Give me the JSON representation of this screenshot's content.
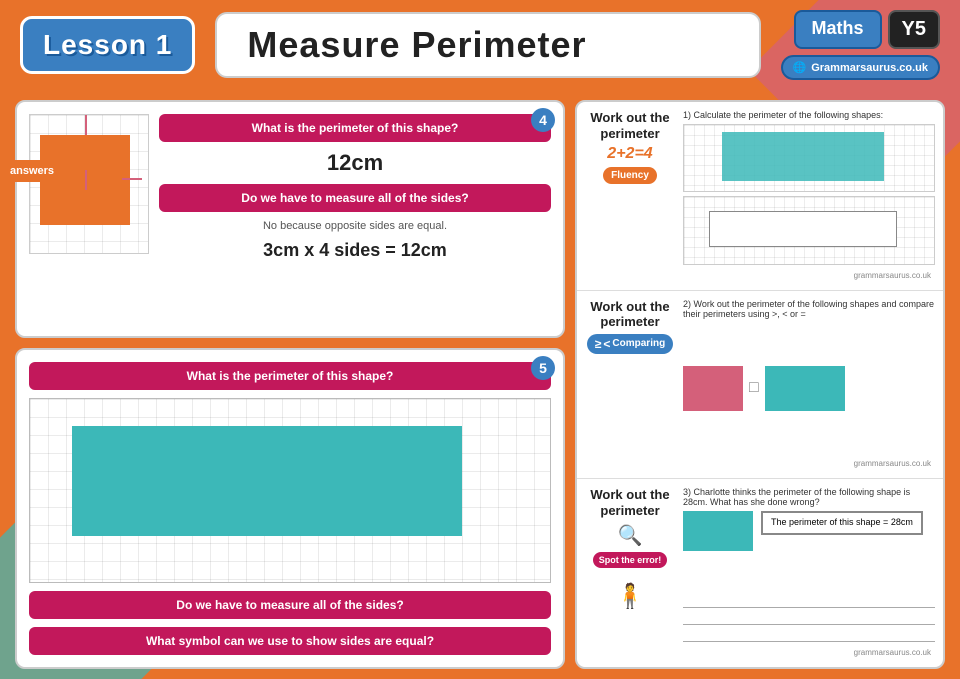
{
  "header": {
    "lesson_label": "Lesson 1",
    "title": "Measure Perimeter",
    "maths_label": "Maths",
    "year_label": "Y5",
    "grammarsaurus_label": "Grammarsaurus.co.uk"
  },
  "slide4": {
    "number": "4",
    "question1": "What is the perimeter of this shape?",
    "answer": "12cm",
    "question2": "Do we have to measure all of the sides?",
    "explanation": "No because opposite sides are equal.",
    "equation": "3cm x 4 sides = 12cm"
  },
  "slide5": {
    "number": "5",
    "question1": "What is the perimeter of this shape?",
    "question2": "Do we have to measure all of the sides?",
    "question3": "What symbol can we use to show sides are equal?"
  },
  "worksheet": {
    "section1": {
      "title": "Work out the perimeter",
      "badge": "Fluency",
      "badge_icon": "2+2=4",
      "instruction": "1) Calculate the perimeter of the following shapes:",
      "grammarsaurus": "grammarsaurus.co.uk"
    },
    "section2": {
      "title": "Work out the perimeter",
      "badge": "Comparing",
      "instruction": "2) Work out the perimeter of the following shapes and compare their perimeters using >, < or =",
      "compare_symbol": "□",
      "grammarsaurus": "grammarsaurus.co.uk"
    },
    "section3": {
      "title": "Work out the perimeter",
      "badge": "Spot the error!",
      "instruction": "3) Charlotte thinks the perimeter of the following shape is 28cm. What has she done wrong?",
      "spot_box_text": "The perimeter of this shape = 28cm",
      "grammarsaurus": "grammarsaurus.co.uk"
    }
  },
  "answers_button": "answers"
}
